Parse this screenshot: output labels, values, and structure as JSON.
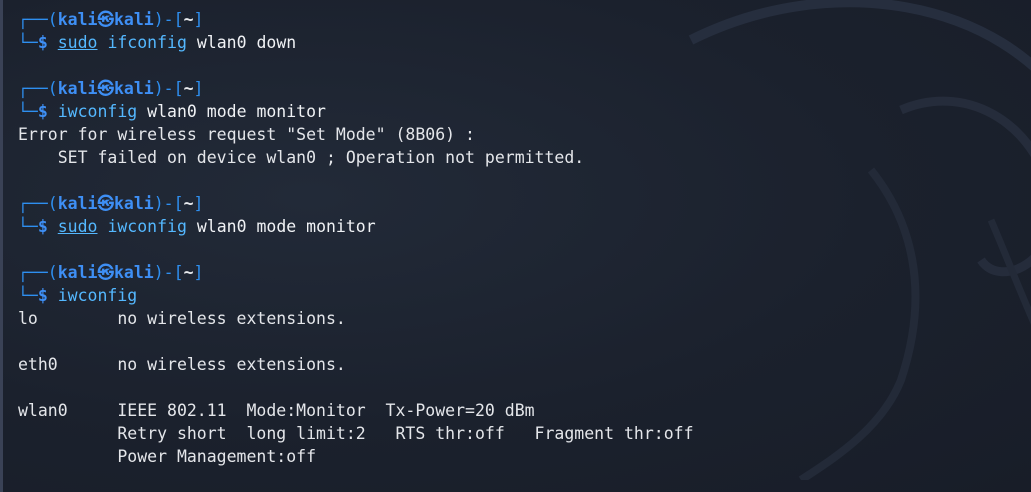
{
  "prompt": {
    "open": "┌──(",
    "user": "kali",
    "at_symbol": "㉿",
    "host": "kali",
    "mid": ")-[",
    "dir": "~",
    "close": "]",
    "corner": "└─",
    "dollar": "$"
  },
  "blocks": [
    {
      "sudo": "sudo",
      "command": "ifconfig",
      "args": "wlan0 down",
      "output": []
    },
    {
      "sudo": "",
      "command": "iwconfig",
      "args": "wlan0 mode monitor",
      "output": [
        "Error for wireless request \"Set Mode\" (8B06) :",
        "    SET failed on device wlan0 ; Operation not permitted."
      ]
    },
    {
      "sudo": "sudo",
      "command": "iwconfig",
      "args": "wlan0 mode monitor",
      "output": []
    },
    {
      "sudo": "",
      "command": "iwconfig",
      "args": "",
      "output": [
        "lo        no wireless extensions.",
        "",
        "eth0      no wireless extensions.",
        "",
        "wlan0     IEEE 802.11  Mode:Monitor  Tx-Power=20 dBm",
        "          Retry short  long limit:2   RTS thr:off   Fragment thr:off",
        "          Power Management:off"
      ]
    }
  ]
}
